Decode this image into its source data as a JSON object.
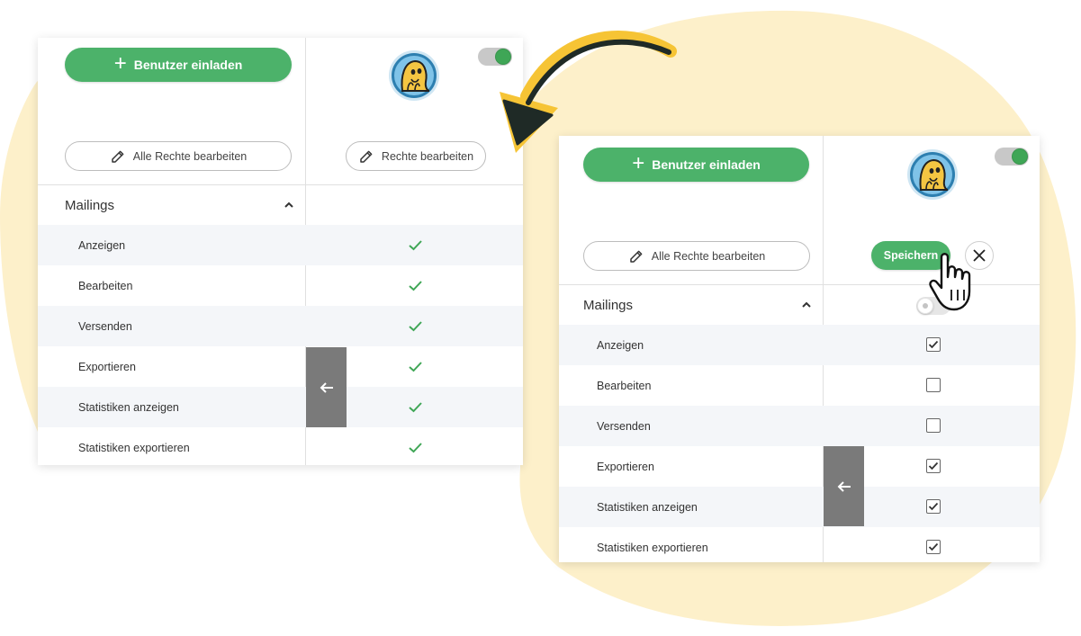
{
  "colors": {
    "brand_green": "#4cb26a",
    "check_green": "#3fa656",
    "background_blob": "#fdf0ca",
    "arrow": "#1f2a26",
    "arrow_highlight": "#f6c435",
    "row_shade": "#f4f6f9",
    "collapse_tab": "#7a7a7a"
  },
  "panels": {
    "before": {
      "invite_button": "Benutzer einladen",
      "edit_all_button": "Alle Rechte bearbeiten",
      "edit_button": "Rechte bearbeiten",
      "active_toggle_on": true,
      "section_title": "Mailings",
      "rows": [
        {
          "label": "Anzeigen",
          "granted": true
        },
        {
          "label": "Bearbeiten",
          "granted": true
        },
        {
          "label": "Versenden",
          "granted": true
        },
        {
          "label": "Exportieren",
          "granted": true
        },
        {
          "label": "Statistiken anzeigen",
          "granted": true
        },
        {
          "label": "Statistiken exportieren",
          "granted": true
        }
      ]
    },
    "after": {
      "invite_button": "Benutzer einladen",
      "edit_all_button": "Alle Rechte bearbeiten",
      "save_button": "Speichern",
      "active_toggle_on": true,
      "section_toggle_on": false,
      "section_title": "Mailings",
      "rows": [
        {
          "label": "Anzeigen",
          "checked": true
        },
        {
          "label": "Bearbeiten",
          "checked": false
        },
        {
          "label": "Versenden",
          "checked": false
        },
        {
          "label": "Exportieren",
          "checked": true
        },
        {
          "label": "Statistiken anzeigen",
          "checked": true
        },
        {
          "label": "Statistiken exportieren",
          "checked": true
        }
      ]
    }
  },
  "icons": {
    "plus": "plus-icon",
    "pencil": "pencil-icon",
    "chevron": "chevron-up-icon",
    "check": "check-icon",
    "back": "arrow-left-icon",
    "close": "close-icon",
    "cursor": "hand-pointer-icon",
    "avatar": "mascot-avatar"
  }
}
